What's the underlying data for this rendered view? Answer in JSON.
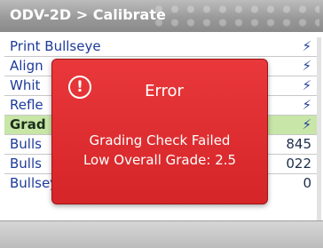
{
  "window": {
    "title": "ODV-2D > Calibrate"
  },
  "list": {
    "items": [
      {
        "label": "Print Bullseye",
        "right": "⚡"
      },
      {
        "label": "Align",
        "right": "⚡"
      },
      {
        "label": "Whit",
        "right": "⚡"
      },
      {
        "label": "Refle",
        "right": "⚡"
      },
      {
        "label": "Grad",
        "right": "⚡",
        "selected": true
      },
      {
        "label": "Bulls",
        "right": "845"
      },
      {
        "label": "Bulls",
        "right": "022"
      },
      {
        "label": "Bullseye Slope",
        "right": "0"
      }
    ]
  },
  "dialog": {
    "icon": "!",
    "title": "Error",
    "line1": "Grading Check Failed",
    "line2": "Low Overall Grade: 2.5"
  },
  "colors": {
    "dialog_red": "#e02d30",
    "selection_green": "#c7e6a7",
    "list_text": "#1c3a9a"
  }
}
